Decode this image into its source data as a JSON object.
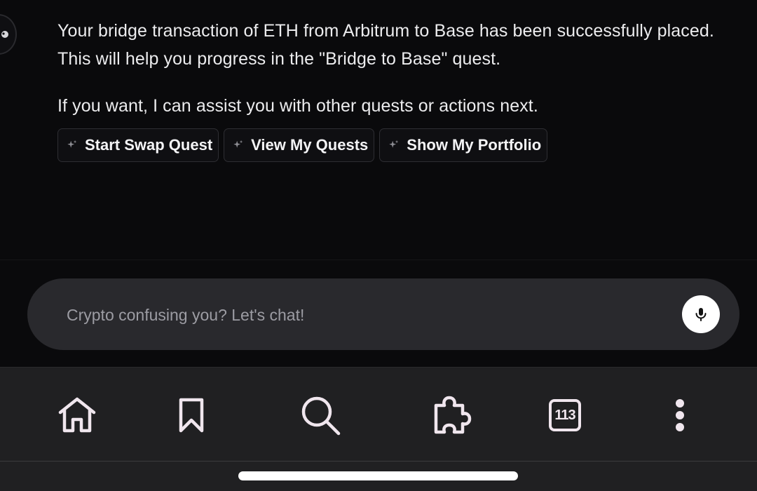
{
  "chat": {
    "message": {
      "paragraph1": "Your bridge transaction of ETH from Arbitrum to Base has been successfully placed. This will help you progress in the \"Bridge to Base\" quest.",
      "paragraph2": "If you want, I can assist you with other quests or actions next."
    },
    "suggestions": [
      {
        "label": "Start Swap Quest",
        "icon": "sparkle-icon"
      },
      {
        "label": "View My Quests",
        "icon": "sparkle-icon"
      },
      {
        "label": "Show My Portfolio",
        "icon": "sparkle-icon"
      }
    ]
  },
  "composer": {
    "placeholder": "Crypto confusing you? Let's chat!",
    "value": "",
    "mic_icon": "microphone-icon"
  },
  "browser_nav": {
    "items": [
      {
        "name": "home",
        "icon": "home-icon"
      },
      {
        "name": "bookmarks",
        "icon": "bookmark-icon"
      },
      {
        "name": "search",
        "icon": "search-icon"
      },
      {
        "name": "extensions",
        "icon": "puzzle-icon"
      },
      {
        "name": "tabs",
        "icon": "tab-count-icon",
        "count": "113"
      },
      {
        "name": "menu",
        "icon": "more-vertical-icon"
      }
    ]
  },
  "colors": {
    "background": "#0a0a0c",
    "text": "#ececee",
    "input_bg": "#29292d",
    "nav_bg": "#202022",
    "icon": "#f0e6ee"
  }
}
